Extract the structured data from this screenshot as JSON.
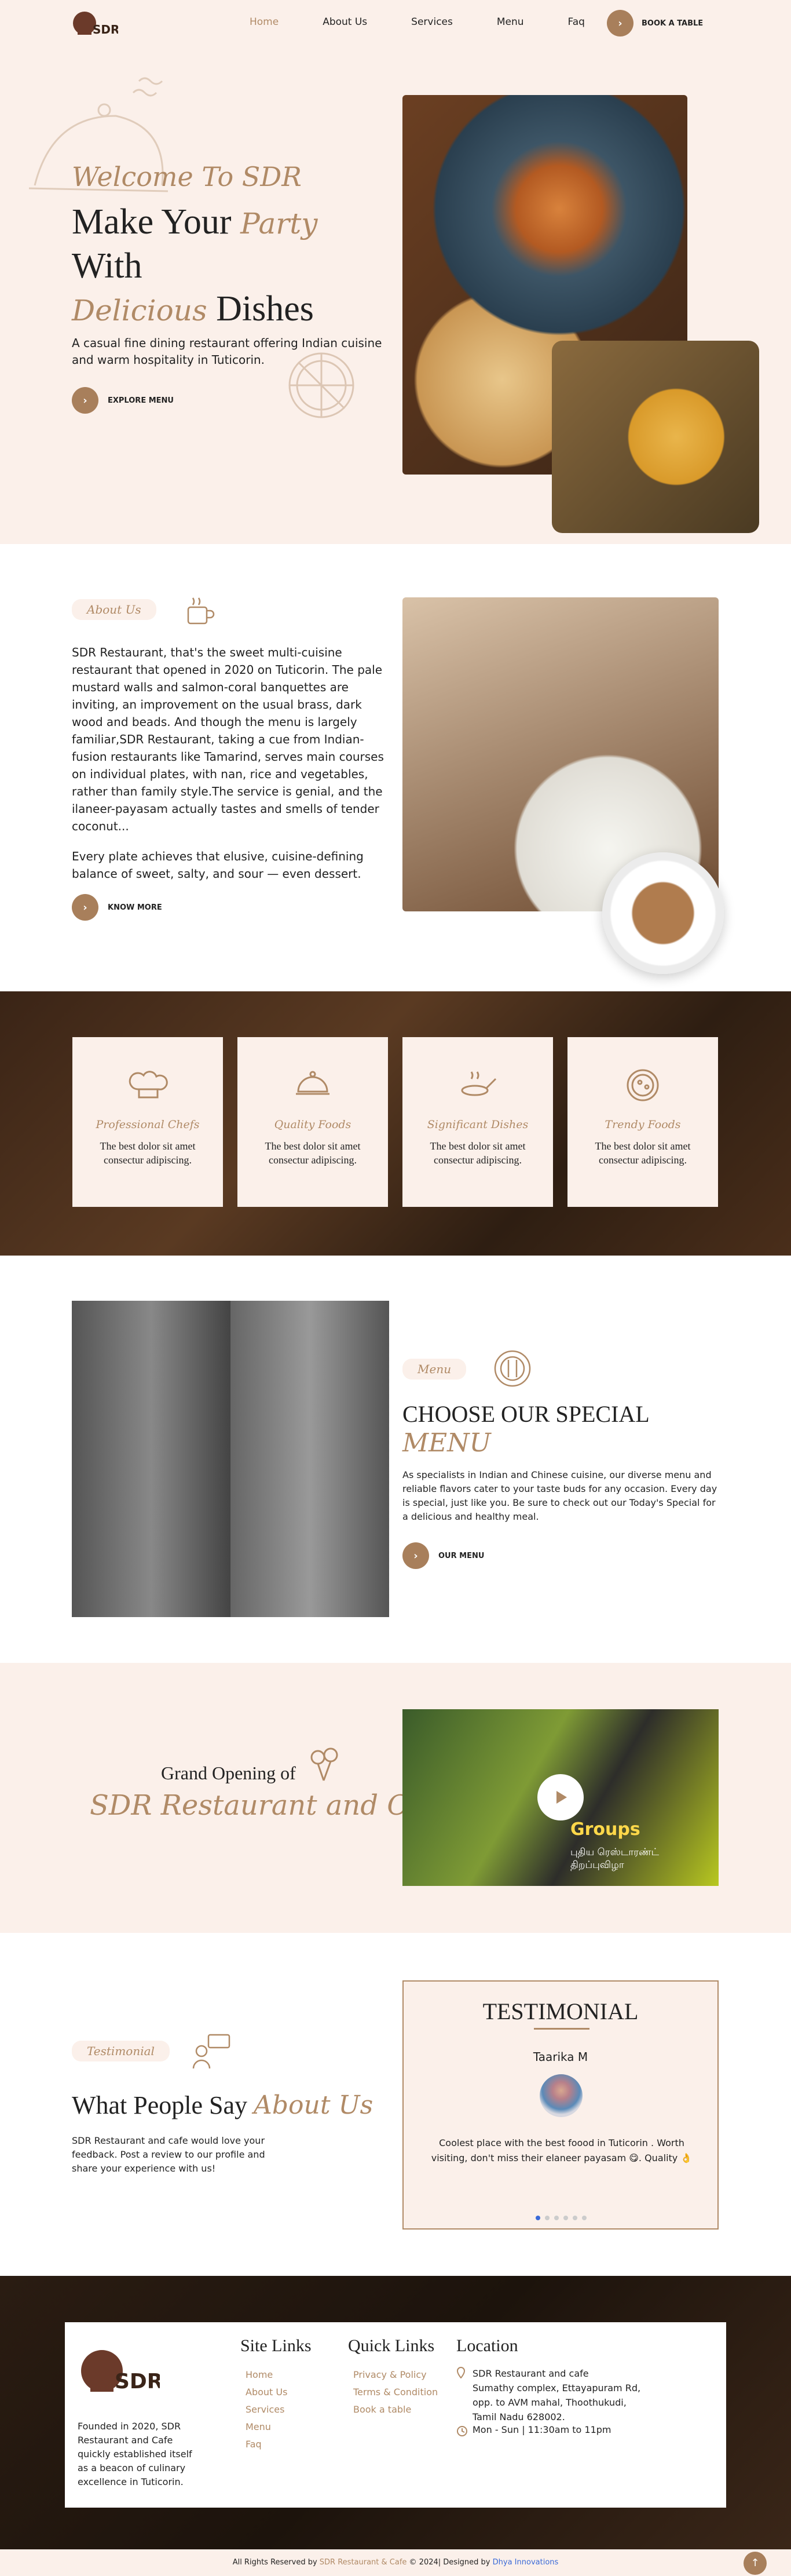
{
  "nav": {
    "items": [
      "Home",
      "About Us",
      "Services",
      "Menu",
      "Faq"
    ],
    "book": "BOOK A TABLE"
  },
  "hero": {
    "welcome": "Welcome To SDR",
    "l1a": "Make Your",
    "l1b": "Party",
    "l2": "With",
    "l3a": "Delicious",
    "l3b": "Dishes",
    "desc": "A casual fine dining restaurant offering Indian cuisine and warm hospitality in Tuticorin.",
    "cta": "EXPLORE MENU"
  },
  "about": {
    "badge": "About Us",
    "p1": "SDR Restaurant, that's the sweet multi-cuisine restaurant that opened in 2020 on Tuticorin. The pale mustard walls and salmon-coral banquettes are inviting, an improvement on the usual brass, dark wood and beads. And though the menu is largely familiar,SDR Restaurant, taking a cue from Indian-fusion restaurants like Tamarind, serves main courses on individual plates, with nan, rice and vegetables, rather than family style.The service is genial, and the ilaneer-payasam actually tastes and smells of tender coconut...",
    "p2": "Every plate achieves that elusive, cuisine-defining balance of sweet, salty, and sour — even dessert.",
    "cta": "KNOW MORE"
  },
  "features": [
    {
      "title": "Professional Chefs",
      "text": "The best dolor sit amet consectur adipiscing."
    },
    {
      "title": "Quality Foods",
      "text": "The best dolor sit amet consectur adipiscing."
    },
    {
      "title": "Significant Dishes",
      "text": "The best dolor sit amet consectur adipiscing."
    },
    {
      "title": "Trendy Foods",
      "text": "The best dolor sit amet consectur adipiscing."
    }
  ],
  "menu": {
    "badge": "Menu",
    "title": "CHOOSE OUR SPECIAL",
    "sub": "MENU",
    "desc": "As specialists in Indian and Chinese cuisine, our diverse menu and reliable flavors cater to your taste buds for any occasion. Every day is special, just like you. Be sure to check out our Today's Special for a delicious and healthy meal.",
    "cta": "OUR MENU"
  },
  "opening": {
    "l1": "Grand Opening of",
    "l2": "SDR Restaurant and Cafe",
    "video_text1": "Groups",
    "video_text2": "புதிய ரெஸ்டாரண்ட் திறப்புவிழா"
  },
  "testimonial": {
    "badge": "Testimonial",
    "ta": "What People Say",
    "tb": "About Us",
    "desc": "SDR Restaurant and cafe would love your feedback. Post a review to our profile and share your experience with us!",
    "card_title": "TESTIMONIAL",
    "name": "Taarika M",
    "quote": "Coolest place with the best foood in Tuticorin . Worth visiting, don't miss their elaneer payasam 😋. Quality 👌"
  },
  "footer": {
    "about": "Founded in 2020, SDR Restaurant and Cafe quickly established itself as a beacon of culinary excellence in Tuticorin.",
    "sitelinks_title": "Site Links",
    "sitelinks": [
      "Home",
      "About Us",
      "Services",
      "Menu",
      "Faq"
    ],
    "quick_title": "Quick Links",
    "quick": [
      "Privacy & Policy",
      "Terms & Condition",
      "Book a table"
    ],
    "loc_title": "Location",
    "address": [
      "SDR Restaurant and cafe",
      "Sumathy complex, Ettayapuram Rd,",
      "opp. to AVM mahal, Thoothukudi,",
      "Tamil Nadu 628002."
    ],
    "hours": "Mon - Sun | 11:30am to 11pm"
  },
  "copyright": {
    "a": "All Rights Reserved by ",
    "b": "SDR Restaurant & Cafe",
    "c": " © 2024| Designed by ",
    "d": "Dhya Innovations"
  }
}
